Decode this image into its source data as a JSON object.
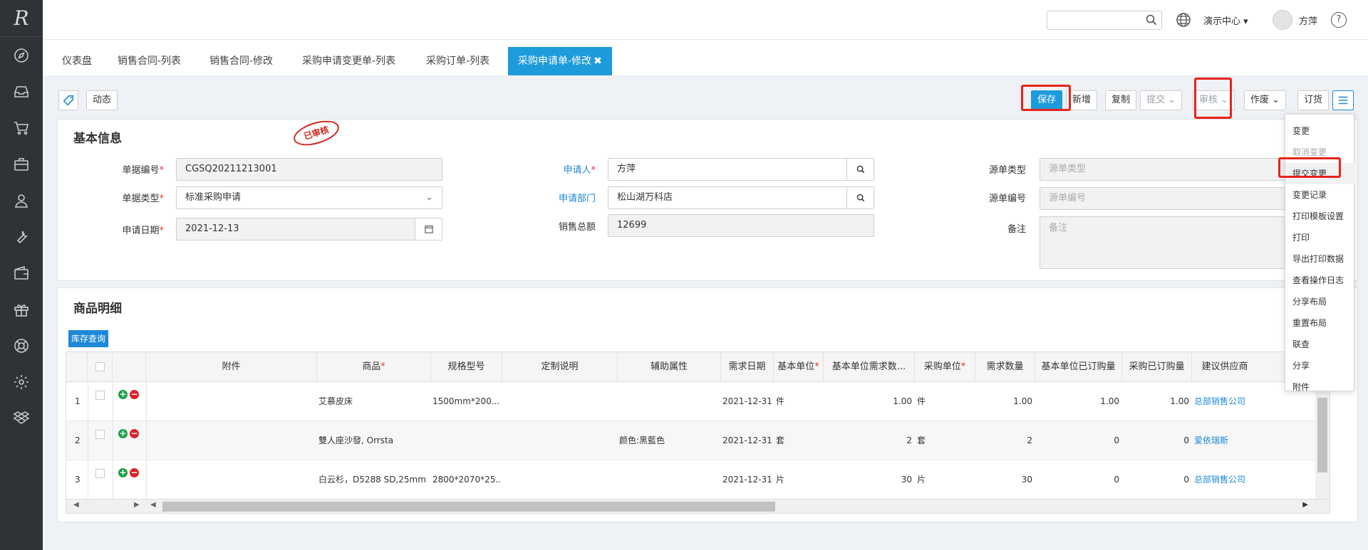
{
  "app": {
    "logo": "R"
  },
  "nav_icons": [
    "compass-icon",
    "inbox-icon",
    "cart-icon",
    "briefcase-icon",
    "user-icon",
    "wrench-icon",
    "wallet-icon",
    "gift-icon",
    "lifebuoy-icon",
    "gear-icon",
    "dropbox-icon"
  ],
  "header": {
    "search_placeholder": "",
    "center_label": "演示中心",
    "user_name": "方萍",
    "help": "?"
  },
  "tabs": [
    {
      "label": "仪表盘"
    },
    {
      "label": "销售合同-列表"
    },
    {
      "label": "销售合同-修改"
    },
    {
      "label": "采购申请变更单-列表"
    },
    {
      "label": "采购订单-列表"
    },
    {
      "label": "采购申请单-修改",
      "close": "✖",
      "active": true
    }
  ],
  "toolbar": {
    "dynamic": "动态",
    "save": "保存",
    "add": "新增",
    "copy": "复制",
    "submit": "提交",
    "audit": "审核",
    "void": "作废",
    "order": "订货"
  },
  "basic": {
    "title": "基本信息",
    "stamp": "已审核",
    "doc_no_label": "单据编号",
    "doc_no": "CGSQ20211213001",
    "doc_type_label": "单据类型",
    "doc_type": "标准采购申请",
    "apply_date_label": "申请日期",
    "apply_date": "2021-12-13",
    "applicant_label": "申请人",
    "applicant": "方萍",
    "dept_label": "申请部门",
    "dept": "松山湖万科店",
    "sales_total_label": "销售总额",
    "sales_total": "12699",
    "src_type_label": "源单类型",
    "src_type_ph": "源单类型",
    "src_no_label": "源单编号",
    "src_no_ph": "源单编号",
    "remark_label": "备注",
    "remark_ph": "备注"
  },
  "detail": {
    "title": "商品明细",
    "stock_btn": "库存查询",
    "headers": {
      "attach": "附件",
      "product": "商品",
      "spec": "规格型号",
      "custom": "定制说明",
      "aux": "辅助属性",
      "need_date": "需求日期",
      "base_unit": "基本单位",
      "base_qty": "基本单位需求数...",
      "pur_unit": "采购单位",
      "qty": "需求数量",
      "base_ordered": "基本单位已订购量",
      "pur_ordered": "采购已订购量",
      "supplier": "建议供应商"
    },
    "rows": [
      {
        "no": "1",
        "product": "艾慕皮床",
        "spec": "1500mm*200...",
        "aux": "",
        "date": "2021-12-31",
        "base_unit": "件",
        "base_qty": "1.00",
        "pur_unit": "件",
        "qty": "1.00",
        "base_ordered": "1.00",
        "pur_ordered": "1.00",
        "supplier": "总部销售公司"
      },
      {
        "no": "2",
        "product": "雙人座沙發, Orrsta",
        "spec": "",
        "aux": "颜色:黑藍色",
        "date": "2021-12-31",
        "base_unit": "套",
        "base_qty": "2",
        "pur_unit": "套",
        "qty": "2",
        "base_ordered": "0",
        "pur_ordered": "0",
        "supplier": "爱依瑞斯"
      },
      {
        "no": "3",
        "product": "白云杉，D5288 SD,25mm",
        "spec": "2800*2070*25...",
        "aux": "",
        "date": "2021-12-31",
        "base_unit": "片",
        "base_qty": "30",
        "pur_unit": "片",
        "qty": "30",
        "base_ordered": "0",
        "pur_ordered": "0",
        "supplier": "总部销售公司"
      }
    ]
  },
  "menu": {
    "items": [
      {
        "label": "变更"
      },
      {
        "label": "取消变更",
        "disabled": true
      },
      {
        "label": "提交变更",
        "highlight": true
      },
      {
        "label": "变更记录"
      },
      {
        "label": "打印模板设置"
      },
      {
        "label": "打印"
      },
      {
        "label": "导出打印数据"
      },
      {
        "label": "查看操作日志"
      },
      {
        "label": "分享布局"
      },
      {
        "label": "重置布局"
      },
      {
        "label": "联查"
      },
      {
        "label": "分享"
      },
      {
        "label": "附件"
      }
    ]
  },
  "colors": {
    "primary": "#1e9bdb",
    "nav_bg": "#2f3337",
    "highlight_box": "#e8231b",
    "link": "#1e88d8",
    "required": "#e5322d"
  }
}
